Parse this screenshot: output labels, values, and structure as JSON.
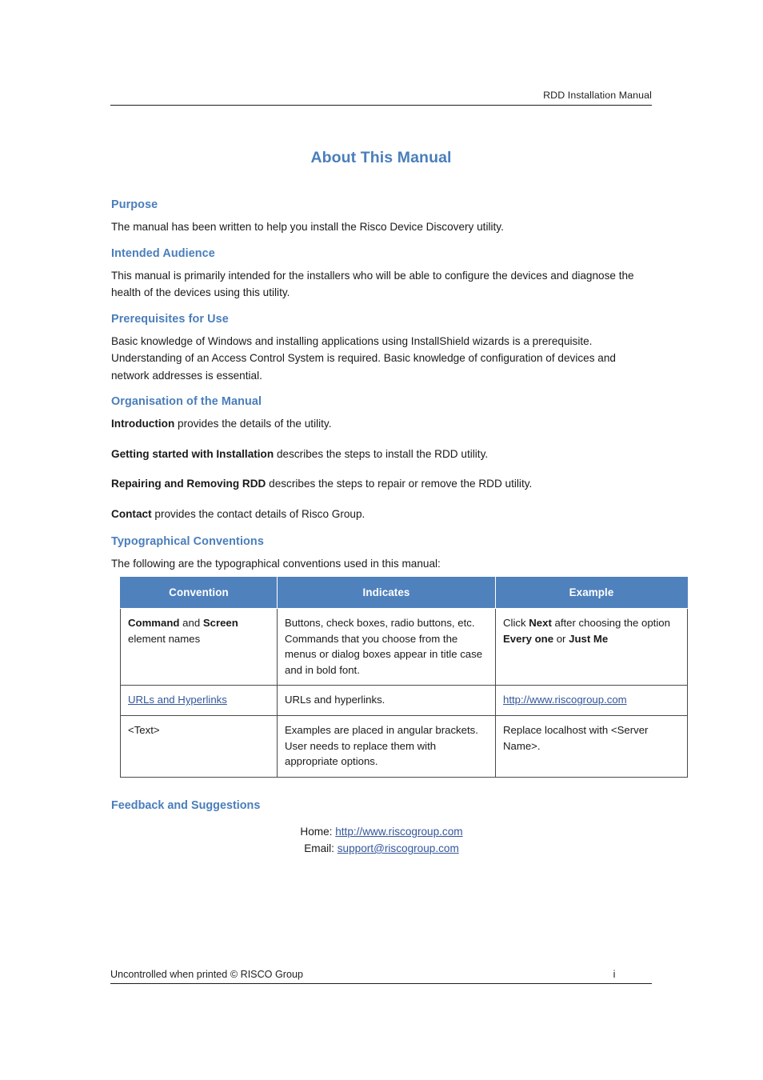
{
  "header": {
    "running_title": "RDD Installation Manual"
  },
  "title": "About This Manual",
  "sections": {
    "purpose": {
      "heading": "Purpose",
      "body": "The manual has been written to help you install the Risco Device Discovery utility."
    },
    "intended_audience": {
      "heading": "Intended Audience",
      "body": "This manual is primarily intended for the installers who will be able to configure the devices and diagnose the health of the devices using this utility."
    },
    "prerequisites": {
      "heading": "Prerequisites for Use",
      "body": "Basic knowledge of Windows and installing applications using InstallShield wizards is a prerequisite. Understanding of an Access Control System is required. Basic knowledge of configuration of devices and network addresses is essential."
    },
    "organisation": {
      "heading": "Organisation of the Manual",
      "items": [
        {
          "lead": "Introduction",
          "rest": " provides the details of the utility."
        },
        {
          "lead": "Getting started with Installation",
          "rest": " describes the steps to install the RDD utility."
        },
        {
          "lead": "Repairing and Removing RDD",
          "rest": " describes the steps to repair or remove the RDD utility."
        },
        {
          "lead": "Contact",
          "rest": " provides the contact details of Risco Group."
        }
      ]
    },
    "typographical": {
      "heading": "Typographical Conventions",
      "intro": "The following are the typographical conventions used in this manual:"
    },
    "feedback": {
      "heading": "Feedback and Suggestions",
      "home_label": "Home: ",
      "home_link": "http://www.riscogroup.com",
      "email_label": "Email: ",
      "email_link": "support@riscogroup.com"
    }
  },
  "table": {
    "columns": [
      "Convention",
      "Indicates",
      "Example"
    ],
    "rows": [
      {
        "convention": {
          "line1_bold_a": "Command",
          "line1_mid": " and ",
          "line1_bold_b": "Screen",
          "line2": "element names"
        },
        "indicates": "Buttons, check boxes, radio buttons, etc. Commands that you choose from the menus or dialog boxes appear in title case and in bold font.",
        "example": {
          "pre": "Click ",
          "bold_a": "Next",
          "mid": " after choosing the option ",
          "bold_b": "Every one",
          "mid2": " or ",
          "bold_c": "Just Me"
        }
      },
      {
        "convention_link": "URLs and Hyperlinks",
        "indicates": "URLs and hyperlinks.",
        "example_link": "http://www.riscogroup.com"
      },
      {
        "convention": "<Text>",
        "indicates": "Examples are placed in angular brackets. User needs to replace them with appropriate options.",
        "example": "Replace localhost with <Server Name>."
      }
    ]
  },
  "footer": {
    "left": "Uncontrolled when printed © RISCO Group",
    "page_number": "i"
  },
  "colors": {
    "heading_blue": "#4a7ebb",
    "table_header_blue": "#4f81bd",
    "link_blue": "#33569c"
  }
}
